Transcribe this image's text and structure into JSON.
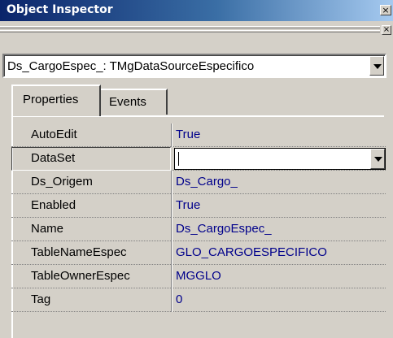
{
  "window": {
    "title": "Object Inspector",
    "close_glyph": "×"
  },
  "component_selector": {
    "value": "Ds_CargoEspec_: TMgDataSourceEspecifico"
  },
  "tabs": [
    {
      "label": "Properties",
      "active": true
    },
    {
      "label": "Events",
      "active": false
    }
  ],
  "properties": [
    {
      "name": "AutoEdit",
      "value": "True"
    },
    {
      "name": "DataSet",
      "value": ""
    },
    {
      "name": "Ds_Origem",
      "value": "Ds_Cargo_"
    },
    {
      "name": "Enabled",
      "value": "True"
    },
    {
      "name": "Name",
      "value": "Ds_CargoEspec_"
    },
    {
      "name": "TableNameEspec",
      "value": "GLO_CARGOESPECIFICO"
    },
    {
      "name": "TableOwnerEspec",
      "value": "MGGLO"
    },
    {
      "name": "Tag",
      "value": "0"
    }
  ],
  "selected_property": "DataSet",
  "colors": {
    "title_gradient_start": "#0a246a",
    "title_gradient_end": "#a6caf0",
    "face": "#d4d0c8",
    "value_text": "#00008b"
  }
}
